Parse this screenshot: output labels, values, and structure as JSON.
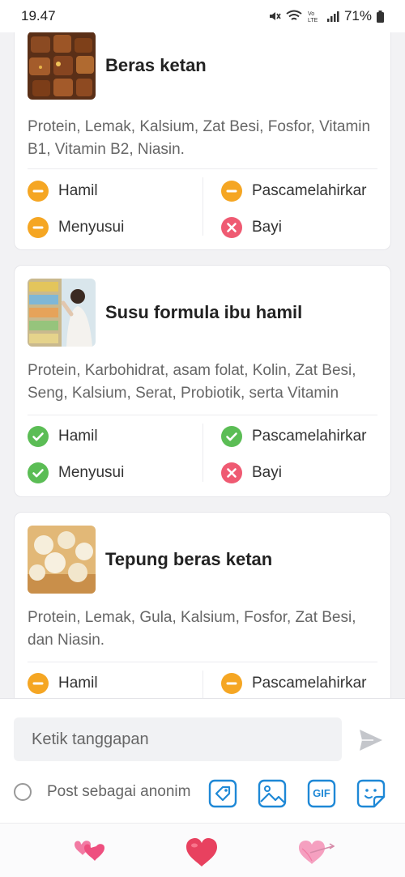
{
  "status_bar": {
    "time": "19.47",
    "battery": "71%"
  },
  "cards": [
    {
      "name": "Beras ketan",
      "nutrients": "Protein, Lemak, Kalsium, Zat Besi, Fosfor, Vitamin B1, Vitamin B2, Niasin.",
      "statuses": [
        {
          "label": "Hamil",
          "state": "caution"
        },
        {
          "label": "Pascamelahirkar",
          "state": "caution"
        },
        {
          "label": "Menyusui",
          "state": "caution"
        },
        {
          "label": "Bayi",
          "state": "no"
        }
      ]
    },
    {
      "name": "Susu formula ibu hamil",
      "nutrients": "Protein, Karbohidrat, asam folat, Kolin, Zat Besi, Seng, Kalsium, Serat, Probiotik, serta Vitamin",
      "statuses": [
        {
          "label": "Hamil",
          "state": "yes"
        },
        {
          "label": "Pascamelahirkar",
          "state": "yes"
        },
        {
          "label": "Menyusui",
          "state": "yes"
        },
        {
          "label": "Bayi",
          "state": "no"
        }
      ]
    },
    {
      "name": "Tepung beras ketan",
      "nutrients": "Protein, Lemak, Gula, Kalsium, Fosfor, Zat Besi, dan Niasin.",
      "statuses": [
        {
          "label": "Hamil",
          "state": "caution"
        },
        {
          "label": "Pascamelahirkar",
          "state": "caution"
        }
      ]
    }
  ],
  "composer": {
    "placeholder": "Ketik tanggapan",
    "anonymous_label": "Post sebagai anonim",
    "gif_label": "GIF"
  },
  "icons": {
    "yes": "check-circle-icon",
    "caution": "minus-circle-icon",
    "no": "x-circle-icon"
  },
  "colors": {
    "yes": "#5bbd55",
    "caution": "#f5a623",
    "no": "#ef5a72",
    "accent": "#1e88d6"
  }
}
